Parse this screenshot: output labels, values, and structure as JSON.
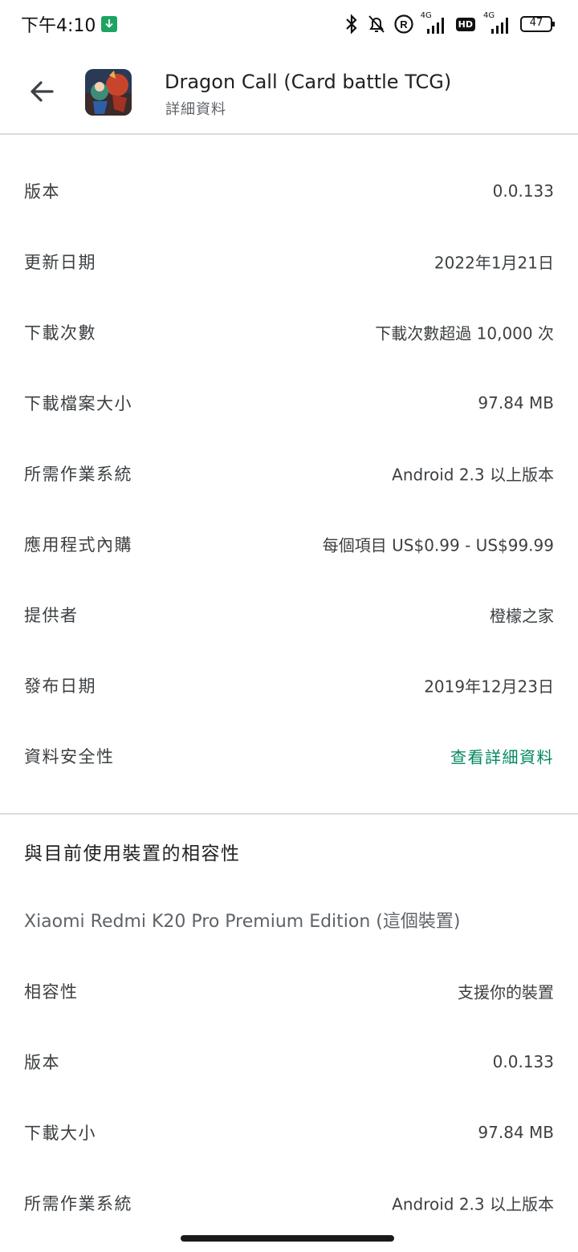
{
  "status_bar": {
    "time": "下午4:10",
    "network_1": "4G",
    "network_2": "4G",
    "hd_badge": "HD",
    "battery": "47"
  },
  "header": {
    "title": "Dragon Call (Card battle TCG)",
    "subtitle": "詳細資料"
  },
  "details": [
    {
      "label": "版本",
      "value": "0.0.133"
    },
    {
      "label": "更新日期",
      "value": "2022年1月21日"
    },
    {
      "label": "下載次數",
      "value": "下載次數超過 10,000 次"
    },
    {
      "label": "下載檔案大小",
      "value": "97.84 MB"
    },
    {
      "label": "所需作業系統",
      "value": "Android 2.3 以上版本"
    },
    {
      "label": "應用程式內購",
      "value": "每個項目 US$0.99 - US$99.99"
    },
    {
      "label": "提供者",
      "value": "橙檬之家"
    },
    {
      "label": "發布日期",
      "value": "2019年12月23日"
    },
    {
      "label": "資料安全性",
      "value": "查看詳細資料"
    }
  ],
  "compatibility": {
    "heading": "與目前使用裝置的相容性",
    "device": "Xiaomi Redmi K20 Pro Premium Edition (這個裝置)",
    "rows": [
      {
        "label": "相容性",
        "value": "支援你的裝置"
      },
      {
        "label": "版本",
        "value": "0.0.133"
      },
      {
        "label": "下載大小",
        "value": "97.84 MB"
      },
      {
        "label": "所需作業系統",
        "value": "Android 2.3 以上版本"
      }
    ]
  },
  "colors": {
    "link": "#01875f",
    "divider": "#dadce0",
    "text": "#3c4043"
  }
}
